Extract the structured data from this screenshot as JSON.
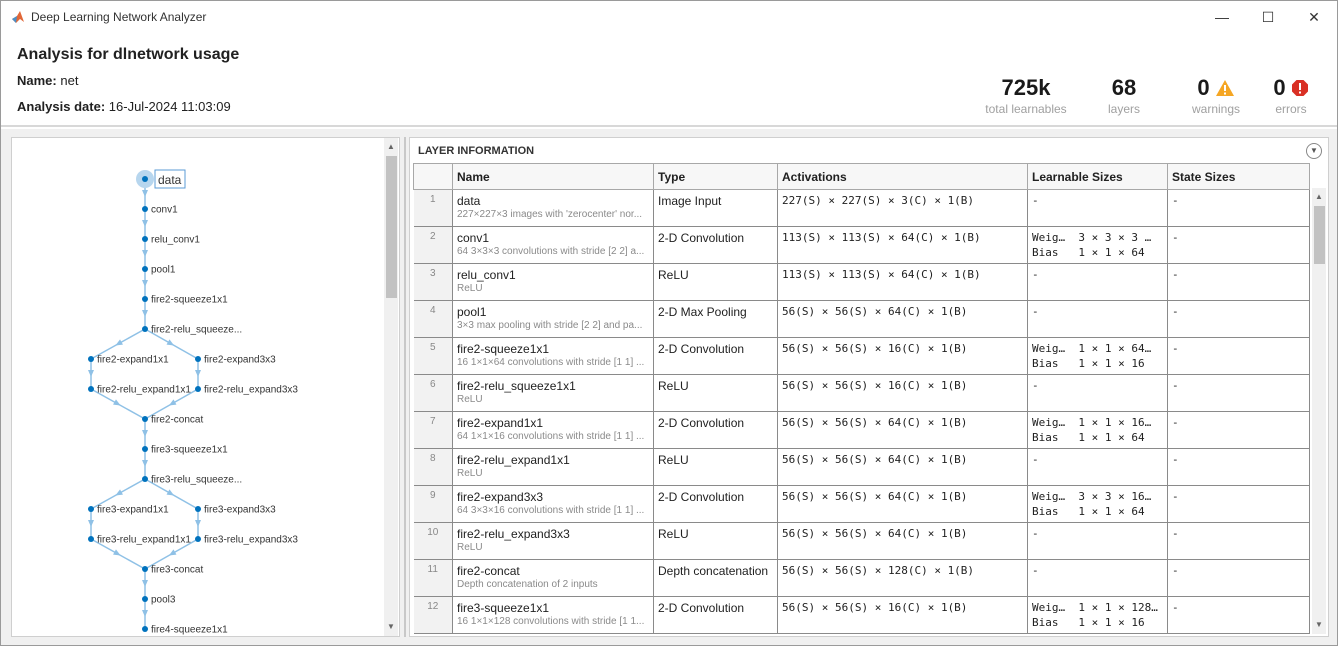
{
  "window": {
    "title": "Deep Learning Network Analyzer",
    "minimize": "—",
    "maximize": "☐",
    "close": "✕"
  },
  "header": {
    "title": "Analysis for dlnetwork usage",
    "name_label": "Name:",
    "name_value": "net",
    "date_label": "Analysis date:",
    "date_value": "16-Jul-2024 11:03:09"
  },
  "stats": [
    {
      "value": "725k",
      "label": "total learnables"
    },
    {
      "value": "68",
      "label": "layers"
    },
    {
      "value": "0",
      "label": "warnings",
      "icon": "warning-icon",
      "color": "#f5a623"
    },
    {
      "value": "0",
      "label": "errors",
      "icon": "error-icon",
      "color": "#d93025"
    }
  ],
  "graph": {
    "accent": "#0072bd",
    "nodes": [
      "data",
      "conv1",
      "relu_conv1",
      "pool1",
      "fire2-squeeze1x1",
      "fire2-relu_squeeze...",
      "fire2-expand1x1",
      "fire2-expand3x3",
      "fire2-relu_expand1x1",
      "fire2-relu_expand3x3",
      "fire2-concat",
      "fire3-squeeze1x1",
      "fire3-relu_squeeze...",
      "fire3-expand1x1",
      "fire3-expand3x3",
      "fire3-relu_expand1x1",
      "fire3-relu_expand3x3",
      "fire3-concat",
      "pool3",
      "fire4-squeeze1x1"
    ]
  },
  "layer_info": {
    "title": "LAYER INFORMATION",
    "columns": [
      "",
      "Name",
      "Type",
      "Activations",
      "Learnable Sizes",
      "State Sizes"
    ],
    "rows": [
      {
        "n": "1",
        "name": "data",
        "desc": "227×227×3 images with 'zerocenter' nor...",
        "type": "Image Input",
        "act": "227(S) × 227(S) × 3(C) × 1(B)",
        "l1": "-",
        "l2": "",
        "state": "-"
      },
      {
        "n": "2",
        "name": "conv1",
        "desc": "64 3×3×3 convolutions with stride [2 2] a...",
        "type": "2-D Convolution",
        "act": "113(S) × 113(S) × 64(C) × 1(B)",
        "l1": "Weig…  3 × 3 × 3 …",
        "l2": "Bias   1 × 1 × 64",
        "state": "-"
      },
      {
        "n": "3",
        "name": "relu_conv1",
        "desc": "ReLU",
        "type": "ReLU",
        "act": "113(S) × 113(S) × 64(C) × 1(B)",
        "l1": "-",
        "l2": "",
        "state": "-"
      },
      {
        "n": "4",
        "name": "pool1",
        "desc": "3×3 max pooling with stride [2 2] and pa...",
        "type": "2-D Max Pooling",
        "act": "56(S) × 56(S) × 64(C) × 1(B)",
        "l1": "-",
        "l2": "",
        "state": "-"
      },
      {
        "n": "5",
        "name": "fire2-squeeze1x1",
        "desc": "16 1×1×64 convolutions with stride [1 1] ...",
        "type": "2-D Convolution",
        "act": "56(S) × 56(S) × 16(C) × 1(B)",
        "l1": "Weig…  1 × 1 × 64…",
        "l2": "Bias   1 × 1 × 16",
        "state": "-"
      },
      {
        "n": "6",
        "name": "fire2-relu_squeeze1x1",
        "desc": "ReLU",
        "type": "ReLU",
        "act": "56(S) × 56(S) × 16(C) × 1(B)",
        "l1": "-",
        "l2": "",
        "state": "-"
      },
      {
        "n": "7",
        "name": "fire2-expand1x1",
        "desc": "64 1×1×16 convolutions with stride [1 1] ...",
        "type": "2-D Convolution",
        "act": "56(S) × 56(S) × 64(C) × 1(B)",
        "l1": "Weig…  1 × 1 × 16…",
        "l2": "Bias   1 × 1 × 64",
        "state": "-"
      },
      {
        "n": "8",
        "name": "fire2-relu_expand1x1",
        "desc": "ReLU",
        "type": "ReLU",
        "act": "56(S) × 56(S) × 64(C) × 1(B)",
        "l1": "-",
        "l2": "",
        "state": "-"
      },
      {
        "n": "9",
        "name": "fire2-expand3x3",
        "desc": "64 3×3×16 convolutions with stride [1 1] ...",
        "type": "2-D Convolution",
        "act": "56(S) × 56(S) × 64(C) × 1(B)",
        "l1": "Weig…  3 × 3 × 16…",
        "l2": "Bias   1 × 1 × 64",
        "state": "-"
      },
      {
        "n": "10",
        "name": "fire2-relu_expand3x3",
        "desc": "ReLU",
        "type": "ReLU",
        "act": "56(S) × 56(S) × 64(C) × 1(B)",
        "l1": "-",
        "l2": "",
        "state": "-"
      },
      {
        "n": "11",
        "name": "fire2-concat",
        "desc": "Depth concatenation of 2 inputs",
        "type": "Depth concatenation",
        "act": "56(S) × 56(S) × 128(C) × 1(B)",
        "l1": "-",
        "l2": "",
        "state": "-"
      },
      {
        "n": "12",
        "name": "fire3-squeeze1x1",
        "desc": "16 1×1×128 convolutions with stride [1 1...",
        "type": "2-D Convolution",
        "act": "56(S) × 56(S) × 16(C) × 1(B)",
        "l1": "Weig…  1 × 1 × 128…",
        "l2": "Bias   1 × 1 × 16",
        "state": "-"
      }
    ]
  }
}
